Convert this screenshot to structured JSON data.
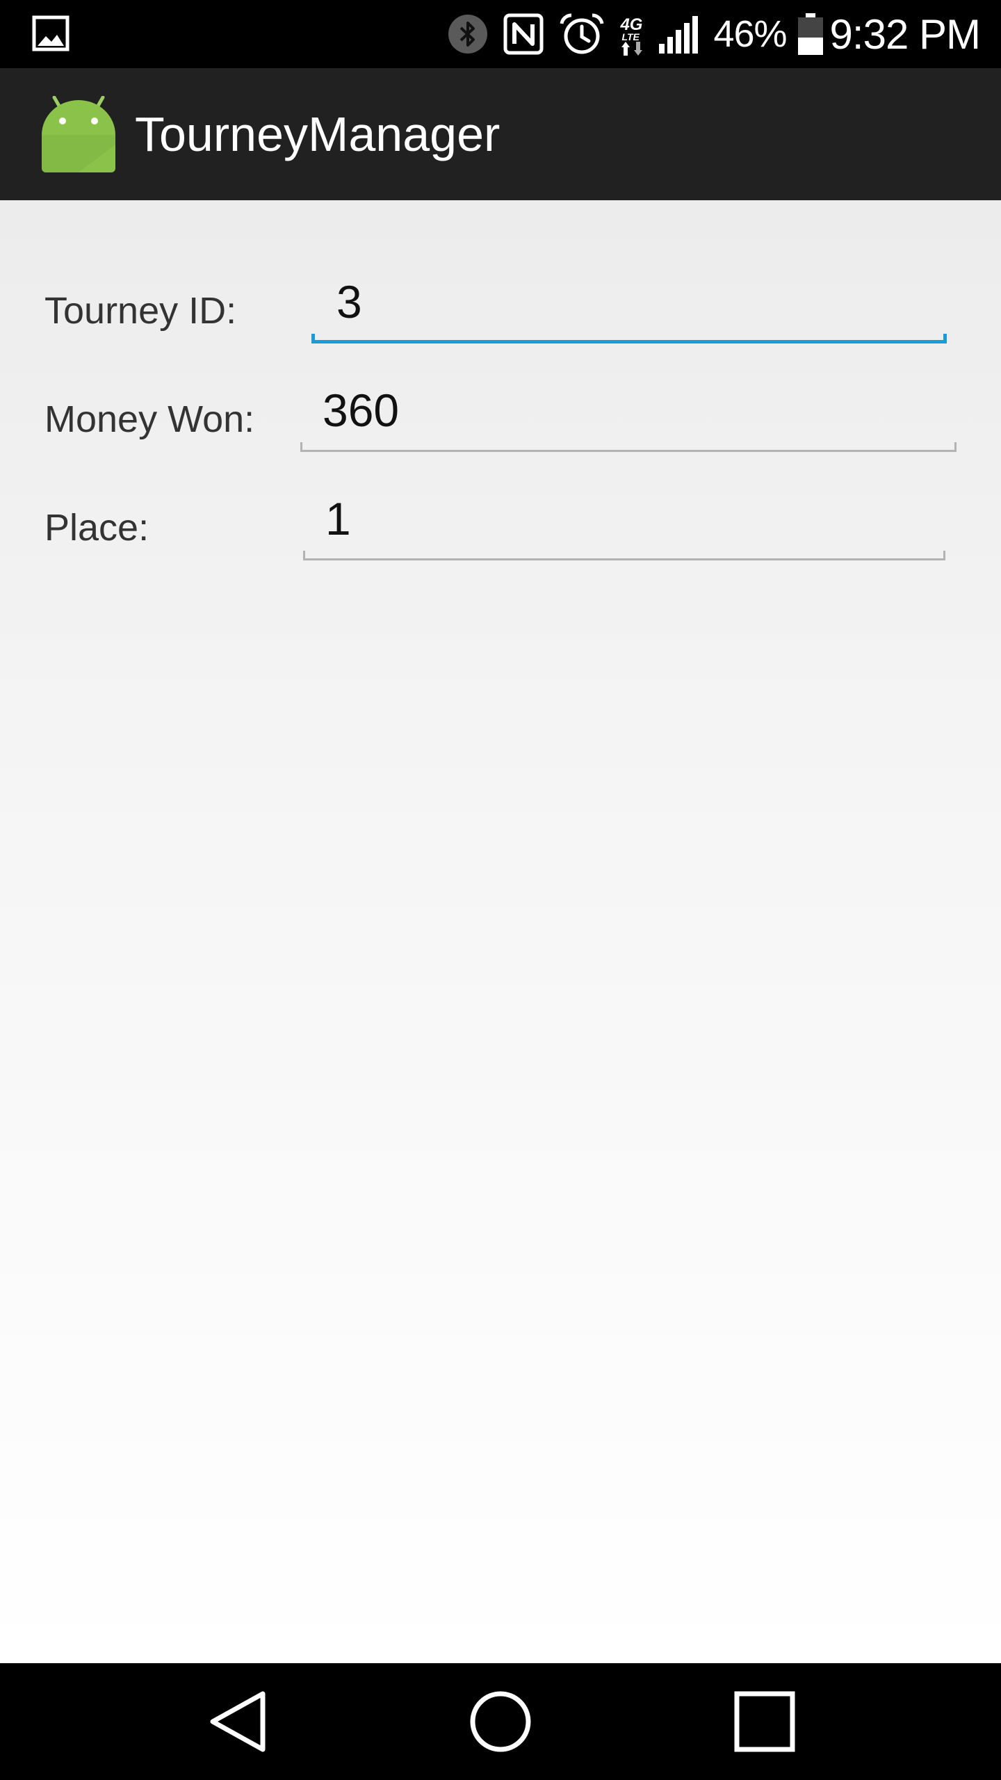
{
  "status_bar": {
    "icons": [
      "gallery-icon",
      "bluetooth-icon",
      "nfc-icon",
      "alarm-icon",
      "4g-lte-icon",
      "signal-icon",
      "battery-icon"
    ],
    "network_label": "4G",
    "network_sublabel": "LTE",
    "battery_percent": "46%",
    "battery_level": 0.46,
    "time": "9:32 PM"
  },
  "action_bar": {
    "app_icon": "android-icon",
    "title": "TourneyManager"
  },
  "form": {
    "rows": [
      {
        "label": "Tourney ID:",
        "value": "3",
        "focused": true
      },
      {
        "label": "Money Won:",
        "value": "360",
        "focused": false
      },
      {
        "label": "Place:",
        "value": "1",
        "focused": false
      }
    ]
  },
  "nav_bar": {
    "buttons": [
      "back-icon",
      "home-icon",
      "recents-icon"
    ]
  },
  "colors": {
    "accent": "#1a9ad6",
    "action_bar_bg": "#212121",
    "android_green": "#8bc34a"
  }
}
